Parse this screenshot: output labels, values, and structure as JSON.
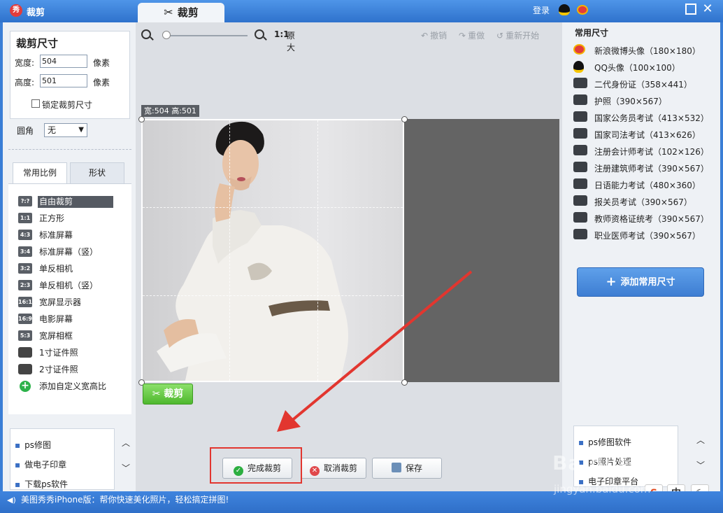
{
  "app": {
    "logo": "秀",
    "title": "裁剪",
    "tab_label": "裁剪",
    "login": "登录"
  },
  "crop_size": {
    "title": "裁剪尺寸",
    "width_label": "宽度:",
    "width_value": "504",
    "width_unit": "像素",
    "height_label": "高度:",
    "height_value": "501",
    "height_unit": "像素",
    "lock_label": "锁定裁剪尺寸"
  },
  "corner": {
    "label": "圆角",
    "value": "无"
  },
  "tabs": [
    {
      "label": "常用比例"
    },
    {
      "label": "形状"
    }
  ],
  "ratios": [
    {
      "badge": "?:?",
      "label": "自由裁剪"
    },
    {
      "badge": "1:1",
      "label": "正方形"
    },
    {
      "badge": "4:3",
      "label": "标准屏幕"
    },
    {
      "badge": "3:4",
      "label": "标准屏幕（竖）"
    },
    {
      "badge": "3:2",
      "label": "单反相机"
    },
    {
      "badge": "2:3",
      "label": "单反相机（竖）"
    },
    {
      "badge": "16:10",
      "label": "宽屏显示器"
    },
    {
      "badge": "16:9",
      "label": "电影屏幕"
    },
    {
      "badge": "5:3",
      "label": "宽屏相框"
    },
    {
      "badge": "",
      "label": "1寸证件照"
    },
    {
      "badge": "",
      "label": "2寸证件照"
    },
    {
      "badge": "+",
      "label": "添加自定义宽高比"
    }
  ],
  "left_links": [
    "ps修图",
    "做电子印章",
    "下载ps软件"
  ],
  "zoom": {
    "ratio": "1:1",
    "original": "原大"
  },
  "history": {
    "undo": "撤销",
    "redo": "重做",
    "restart": "重新开始"
  },
  "crop_badge": "宽:504 高:501",
  "crop_button": "裁剪",
  "bottom_buttons": {
    "finish": "完成裁剪",
    "cancel": "取消裁剪",
    "save": "保存"
  },
  "presets_title": "常用尺寸",
  "presets": [
    {
      "icon": "weibo",
      "label": "新浪微博头像（180×180）"
    },
    {
      "icon": "qq",
      "label": "QQ头像（100×100）"
    },
    {
      "icon": "id",
      "label": "二代身份证（358×441）"
    },
    {
      "icon": "id",
      "label": "护照（390×567）"
    },
    {
      "icon": "id",
      "label": "国家公务员考试（413×532）"
    },
    {
      "icon": "id",
      "label": "国家司法考试（413×626）"
    },
    {
      "icon": "id",
      "label": "注册会计师考试（102×126）"
    },
    {
      "icon": "id",
      "label": "注册建筑师考试（390×567）"
    },
    {
      "icon": "id",
      "label": "日语能力考试（480×360）"
    },
    {
      "icon": "id",
      "label": "报关员考试（390×567）"
    },
    {
      "icon": "id",
      "label": "教师资格证统考（390×567）"
    },
    {
      "icon": "id",
      "label": "职业医师考试（390×567）"
    }
  ],
  "add_preset": "添加常用尺寸",
  "right_links": [
    "ps修图软件",
    "ps照片处理",
    "电子印章平台"
  ],
  "ime": {
    "lang": "中"
  },
  "status": "美图秀秀iPhone版：帮你快速美化照片，轻松搞定拼图!",
  "watermark": {
    "main": "Baidu经验",
    "sub": "jingyan.baidu.com"
  },
  "colors": {
    "accent": "#3a7ed6",
    "highlight": "#e2362f",
    "green": "#4fb82e"
  }
}
